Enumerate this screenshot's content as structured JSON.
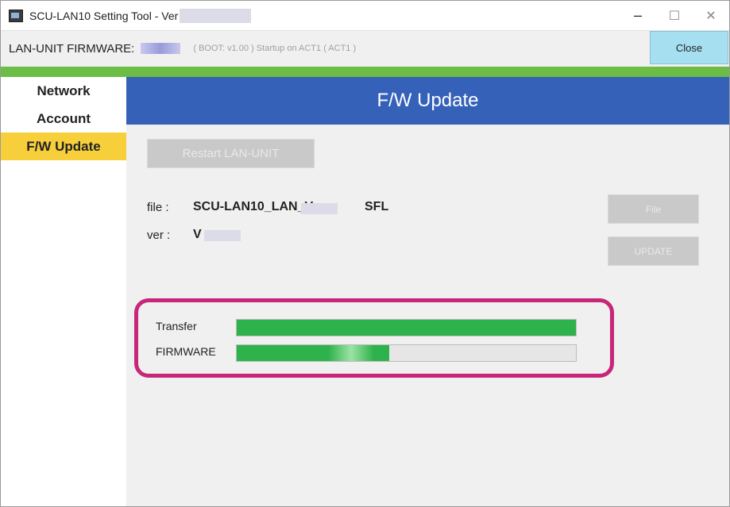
{
  "window": {
    "title": "SCU-LAN10 Setting Tool - Ver",
    "controls": {
      "minimize": "–",
      "maximize": "☐",
      "close": "✕"
    }
  },
  "firmware_bar": {
    "label": "LAN-UNIT FIRMWARE:",
    "status": "( BOOT: v1.00 ) Startup on ACT1 ( ACT1 )",
    "close_label": "Close"
  },
  "sidebar": {
    "items": [
      {
        "label": "Network",
        "active": false
      },
      {
        "label": "Account",
        "active": false
      },
      {
        "label": "F/W Update",
        "active": true
      }
    ]
  },
  "main": {
    "title": "F/W Update",
    "restart_label": "Restart LAN-UNIT",
    "file": {
      "label": "file :",
      "value_prefix": "SCU-LAN10_LAN_V",
      "value_suffix": "SFL"
    },
    "ver": {
      "label": "ver :",
      "value_prefix": "V"
    },
    "file_button": "File",
    "update_button": "UPDATE",
    "progress": {
      "transfer": {
        "label": "Transfer",
        "percent": 100
      },
      "firmware": {
        "label": "FIRMWARE",
        "percent": 45
      }
    }
  },
  "colors": {
    "header_blue": "#3561b9",
    "accent_green": "#6cbd45",
    "active_nav": "#f6cf3a",
    "progress_green": "#2eb24b",
    "highlight_magenta": "#c8267a",
    "close_button": "#a6dff0"
  },
  "icons": {
    "app": "app-window-icon"
  }
}
